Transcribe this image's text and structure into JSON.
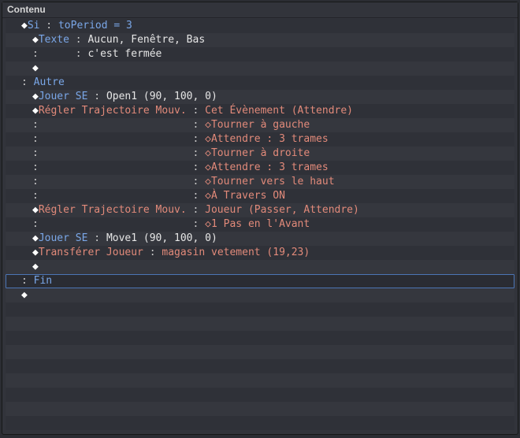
{
  "panel": {
    "title": "Contenu"
  },
  "rows": [
    {
      "i": 1,
      "d": "f",
      "kClass": "kw-blue",
      "k": "Si",
      "colon": " : ",
      "vClass": "kw-blue",
      "v": "toPeriod = 3"
    },
    {
      "i": 2,
      "d": "f",
      "kClass": "kw-blue",
      "k": "Texte",
      "colon": " : ",
      "vClass": "txt-white",
      "v": "Aucun, Fenêtre, Bas"
    },
    {
      "i": 2,
      "d": "",
      "kClass": "colon",
      "k": ":     ",
      "colon": " : ",
      "vClass": "txt-white",
      "v": "c'est fermée"
    },
    {
      "i": 2,
      "d": "f",
      "kClass": "",
      "k": "",
      "colon": "",
      "vClass": "",
      "v": ""
    },
    {
      "i": 1,
      "d": "",
      "kClass": "colon",
      "k": ": ",
      "colon": "",
      "vClass": "kw-blue",
      "v": "Autre"
    },
    {
      "i": 2,
      "d": "f",
      "kClass": "kw-blue",
      "k": "Jouer SE",
      "colon": " : ",
      "vClass": "txt-white",
      "v": "Open1 (90, 100, 0)"
    },
    {
      "i": 2,
      "d": "f",
      "kClass": "kw-salmon",
      "k": "Régler Trajectoire Mouv.",
      "colon": " : ",
      "vClass": "kw-salmon",
      "v": "Cet Évènement (Attendre)"
    },
    {
      "i": 2,
      "d": "",
      "kClass": "colon",
      "k": ":                        ",
      "colon": " : ",
      "vClass": "kw-salmon",
      "v": "◇Tourner à gauche"
    },
    {
      "i": 2,
      "d": "",
      "kClass": "colon",
      "k": ":                        ",
      "colon": " : ",
      "vClass": "kw-salmon",
      "v": "◇Attendre : 3 trames"
    },
    {
      "i": 2,
      "d": "",
      "kClass": "colon",
      "k": ":                        ",
      "colon": " : ",
      "vClass": "kw-salmon",
      "v": "◇Tourner à droite"
    },
    {
      "i": 2,
      "d": "",
      "kClass": "colon",
      "k": ":                        ",
      "colon": " : ",
      "vClass": "kw-salmon",
      "v": "◇Attendre : 3 trames"
    },
    {
      "i": 2,
      "d": "",
      "kClass": "colon",
      "k": ":                        ",
      "colon": " : ",
      "vClass": "kw-salmon",
      "v": "◇Tourner vers le haut"
    },
    {
      "i": 2,
      "d": "",
      "kClass": "colon",
      "k": ":                        ",
      "colon": " : ",
      "vClass": "kw-salmon",
      "v": "◇À Travers ON"
    },
    {
      "i": 2,
      "d": "f",
      "kClass": "kw-salmon",
      "k": "Régler Trajectoire Mouv.",
      "colon": " : ",
      "vClass": "kw-salmon",
      "v": "Joueur (Passer, Attendre)"
    },
    {
      "i": 2,
      "d": "",
      "kClass": "colon",
      "k": ":                        ",
      "colon": " : ",
      "vClass": "kw-salmon",
      "v": "◇1 Pas en l'Avant"
    },
    {
      "i": 2,
      "d": "f",
      "kClass": "kw-blue",
      "k": "Jouer SE",
      "colon": " : ",
      "vClass": "txt-white",
      "v": "Move1 (90, 100, 0)"
    },
    {
      "i": 2,
      "d": "f",
      "kClass": "kw-salmon",
      "k": "Transférer Joueur",
      "colon": " : ",
      "vClass": "kw-salmon",
      "v": "magasin vetement (19,23)"
    },
    {
      "i": 2,
      "d": "f",
      "kClass": "",
      "k": "",
      "colon": "",
      "vClass": "",
      "v": ""
    },
    {
      "i": 1,
      "d": "",
      "kClass": "colon",
      "k": ": ",
      "colon": "",
      "vClass": "kw-blue",
      "v": "Fin",
      "selected": true
    },
    {
      "i": 1,
      "d": "f",
      "kClass": "",
      "k": "",
      "colon": "",
      "vClass": "",
      "v": ""
    }
  ],
  "blankRows": 9,
  "glyphs": {
    "filled": "◆",
    "outline": "◇"
  }
}
